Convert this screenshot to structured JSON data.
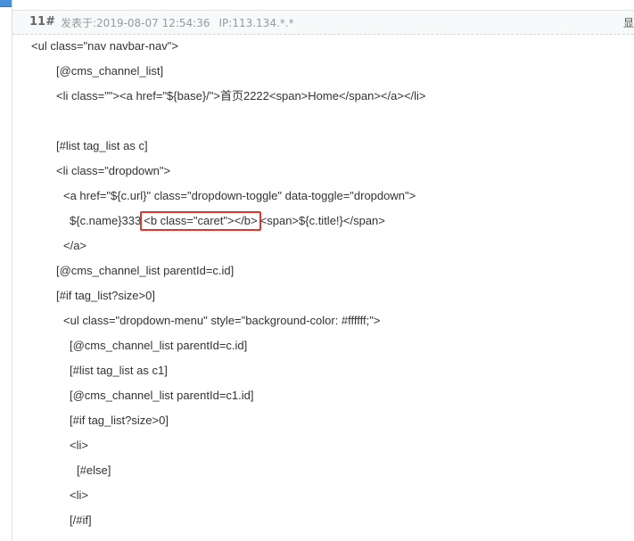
{
  "post": {
    "number": "11#",
    "posted_label": "发表于:",
    "posted_at": "2019-08-07 12:54:36",
    "ip_label": "IP:",
    "ip": "113.134.*.*",
    "header_link": "显"
  },
  "code": {
    "lines": [
      "<ul class=\"nav navbar-nav\">",
      "[@cms_channel_list]",
      "<li class=\"\"><a href=\"${base}/\">首页2222<span>Home</span></a></li>",
      "",
      "[#list tag_list as c]",
      "<li class=\"dropdown\">",
      "<a href=\"${c.url}\" class=\"dropdown-toggle\" data-toggle=\"dropdown\">",
      "${c.name}333",
      "</a>",
      "[@cms_channel_list parentId=c.id]",
      "[#if tag_list?size>0]",
      "<ul class=\"dropdown-menu\" style=\"background-color: #ffffff;\">",
      "[@cms_channel_list parentId=c.id]",
      "[#list tag_list as c1]",
      "[@cms_channel_list parentId=c1.id]",
      "[#if tag_list?size>0]",
      "<li>",
      "[#else]",
      "<li>",
      "[/#if]"
    ],
    "highlighted": "<b class=\"caret\"></b>",
    "after_highlight": "<span>${c.title!}</span>"
  },
  "colors": {
    "highlight_border": "#e0352b",
    "text": "#333333",
    "meta": "#999999",
    "header_bg": "#f7f9fb"
  }
}
